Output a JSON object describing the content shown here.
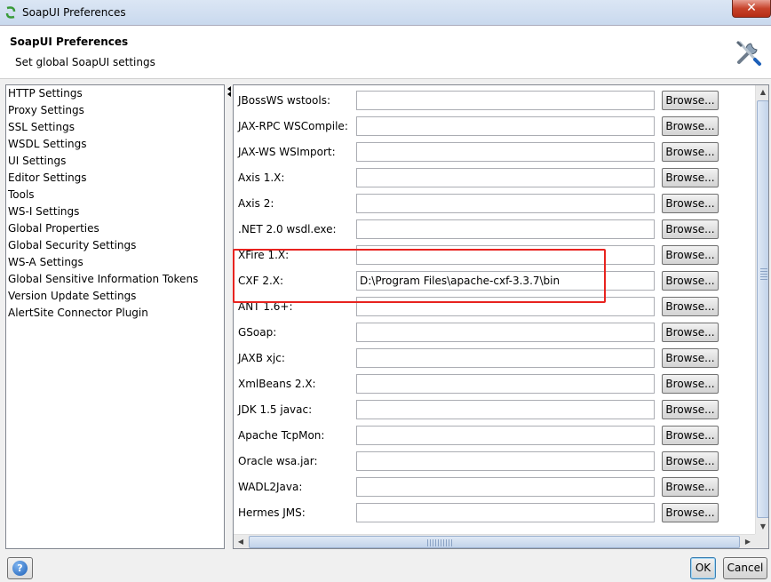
{
  "window": {
    "title": "SoapUI Preferences",
    "close_label": "✕"
  },
  "header": {
    "title": "SoapUI Preferences",
    "description": "Set global SoapUI settings"
  },
  "nav": {
    "items": [
      {
        "label": "HTTP Settings"
      },
      {
        "label": "Proxy Settings"
      },
      {
        "label": "SSL Settings"
      },
      {
        "label": "WSDL Settings"
      },
      {
        "label": "UI Settings"
      },
      {
        "label": "Editor Settings"
      },
      {
        "label": "Tools"
      },
      {
        "label": "WS-I Settings"
      },
      {
        "label": "Global Properties"
      },
      {
        "label": "Global Security Settings"
      },
      {
        "label": "WS-A Settings"
      },
      {
        "label": "Global Sensitive Information Tokens"
      },
      {
        "label": "Version Update Settings"
      },
      {
        "label": "AlertSite Connector Plugin"
      }
    ]
  },
  "tools": {
    "browse_label": "Browse...",
    "rows": [
      {
        "label": "JBossWS wstools:",
        "value": ""
      },
      {
        "label": "JAX-RPC WSCompile:",
        "value": ""
      },
      {
        "label": "JAX-WS WSImport:",
        "value": ""
      },
      {
        "label": "Axis 1.X:",
        "value": ""
      },
      {
        "label": "Axis 2:",
        "value": ""
      },
      {
        "label": ".NET 2.0 wsdl.exe:",
        "value": ""
      },
      {
        "label": "XFire 1.X:",
        "value": ""
      },
      {
        "label": "CXF 2.X:",
        "value": "D:\\Program Files\\apache-cxf-3.3.7\\bin"
      },
      {
        "label": "ANT 1.6+:",
        "value": ""
      },
      {
        "label": "GSoap:",
        "value": ""
      },
      {
        "label": "JAXB xjc:",
        "value": ""
      },
      {
        "label": "XmlBeans 2.X:",
        "value": ""
      },
      {
        "label": "JDK 1.5 javac:",
        "value": ""
      },
      {
        "label": "Apache TcpMon:",
        "value": ""
      },
      {
        "label": "Oracle wsa.jar:",
        "value": ""
      },
      {
        "label": "WADL2Java:",
        "value": ""
      },
      {
        "label": "Hermes JMS:",
        "value": ""
      }
    ]
  },
  "footer": {
    "help_label": "?",
    "ok_label": "OK",
    "cancel_label": "Cancel"
  },
  "colors": {
    "highlight": "#e8231f",
    "accent": "#1c5fb8"
  }
}
